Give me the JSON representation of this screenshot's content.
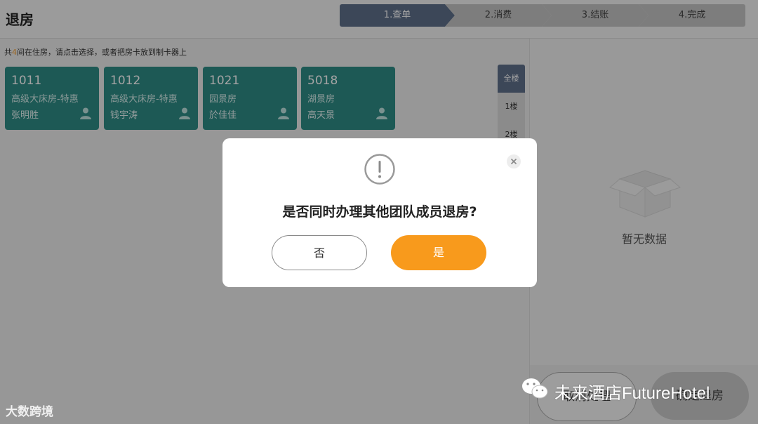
{
  "header": {
    "title": "退房",
    "steps": [
      "1.查单",
      "2.消费",
      "3.结账",
      "4.完成"
    ]
  },
  "hint": {
    "prefix": "共",
    "count": "4",
    "suffix": "间在住房，请点击选择，或者把房卡放到制卡器上"
  },
  "rooms": [
    {
      "number": "1011",
      "type": "高级大床房-特惠",
      "guest": "张明胜"
    },
    {
      "number": "1012",
      "type": "高级大床房-特惠",
      "guest": "钱宇涛"
    },
    {
      "number": "1021",
      "type": "园景房",
      "guest": "於佳佳"
    },
    {
      "number": "5018",
      "type": "湖景房",
      "guest": "高天景"
    }
  ],
  "floors": [
    "全楼",
    "1楼",
    "2楼"
  ],
  "right_panel": {
    "empty_text": "暂无数据",
    "left_button": "取消处理",
    "right_button": "确定退房"
  },
  "dialog": {
    "question": "是否同时办理其他团队成员退房?",
    "no_label": "否",
    "yes_label": "是"
  },
  "watermarks": {
    "left": "大数跨境",
    "right": "未来酒店FutureHotel"
  },
  "colors": {
    "room_card": "#2e8b86",
    "active_step": "#5f6f8a",
    "accent": "#f89a1c"
  }
}
